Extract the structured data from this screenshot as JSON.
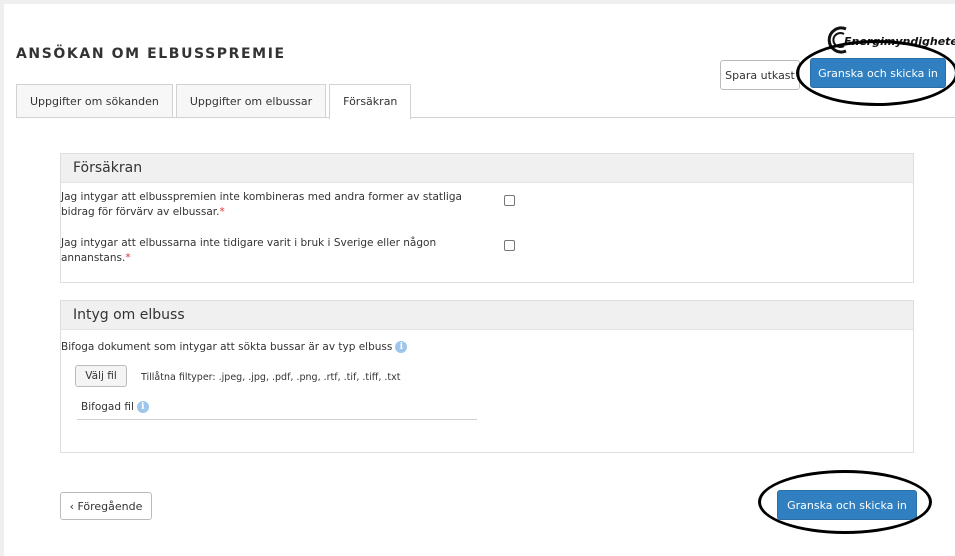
{
  "header": {
    "title": "ANSÖKAN OM ELBUSSPREMIE",
    "logo_text": "Energimyndigheten",
    "save_draft_label": "Spara utkast",
    "review_submit_label": "Granska och skicka in"
  },
  "tabs": [
    {
      "label": "Uppgifter om sökanden"
    },
    {
      "label": "Uppgifter om elbussar"
    },
    {
      "label": "Försäkran"
    }
  ],
  "forsakran": {
    "heading": "Försäkran",
    "q1": "Jag intygar att elbusspremien inte kombineras med andra former av statliga bidrag för förvärv av elbussar.",
    "q2": "Jag intygar att elbussarna inte tidigare varit i bruk i Sverige eller någon annanstans.",
    "required_mark": "*"
  },
  "intyg": {
    "heading": "Intyg om elbuss",
    "attach_text": "Bifoga dokument som intygar att sökta bussar är av typ elbuss",
    "choose_file_label": "Välj fil",
    "allowed_types": "Tillåtna filtyper: .jpeg, .jpg, .pdf, .png, .rtf, .tif, .tiff, .txt",
    "attached_file_label": "Bifogad fil",
    "info_glyph": "i"
  },
  "footer": {
    "prev_label": "‹ Föregående",
    "review_submit_label": "Granska och skicka in"
  },
  "colors": {
    "primary": "#2f7fc1",
    "required": "#d33333",
    "info": "#9dc6ea"
  }
}
